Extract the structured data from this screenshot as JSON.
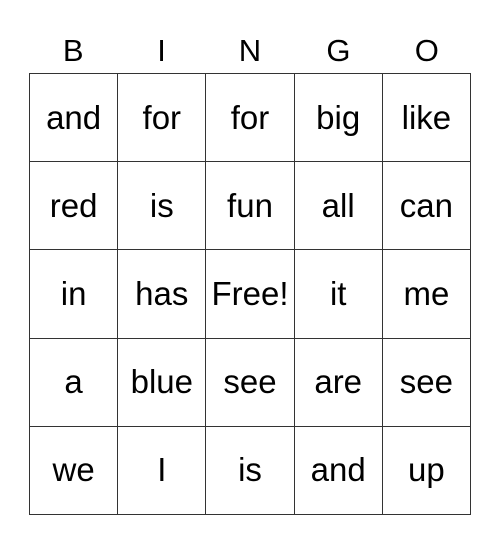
{
  "header": [
    "B",
    "I",
    "N",
    "G",
    "O"
  ],
  "rows": [
    [
      "and",
      "for",
      "for",
      "big",
      "like"
    ],
    [
      "red",
      "is",
      "fun",
      "all",
      "can"
    ],
    [
      "in",
      "has",
      "Free!",
      "it",
      "me"
    ],
    [
      "a",
      "blue",
      "see",
      "are",
      "see"
    ],
    [
      "we",
      "I",
      "is",
      "and",
      "up"
    ]
  ]
}
